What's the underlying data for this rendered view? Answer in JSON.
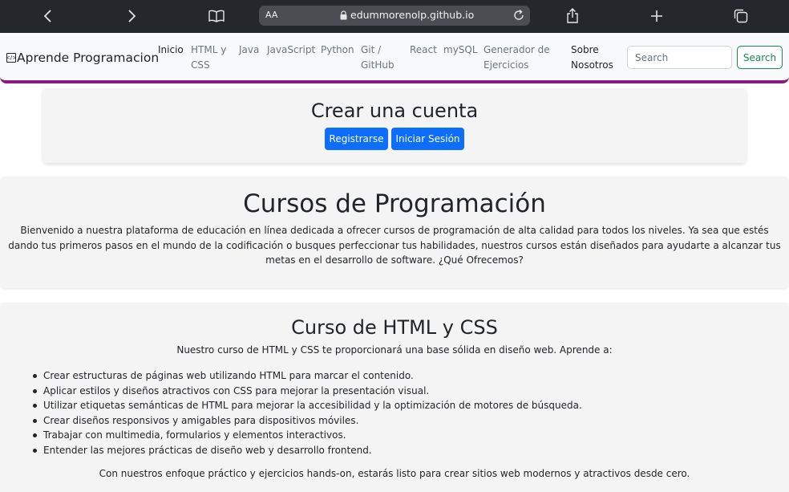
{
  "browser": {
    "text_size_label": "AA",
    "url": "edummorenolp.github.io",
    "icons": [
      "back-icon",
      "forward-icon",
      "bookmarks-icon",
      "lock-icon",
      "reload-icon",
      "share-icon",
      "new-tab-icon",
      "tabs-icon"
    ]
  },
  "navbar": {
    "brand": "Aprende Programacion",
    "links": [
      {
        "label": "Inicio",
        "active": true
      },
      {
        "label": "HTML y\nCSS"
      },
      {
        "label": "Java"
      },
      {
        "label": "JavaScript"
      },
      {
        "label": "Python"
      },
      {
        "label": "Git /\nGitHub"
      },
      {
        "label": "React"
      },
      {
        "label": "mySQL"
      },
      {
        "label": "Generador de\nEjercicios"
      },
      {
        "label": "Sobre\nNosotros",
        "active": true
      }
    ],
    "search_placeholder": "Search",
    "search_button": "Search",
    "accent_color": "#8a1a7e"
  },
  "account": {
    "title": "Crear una cuenta",
    "register_button": "Registrarse",
    "login_button": "Iniciar Sesión"
  },
  "hero": {
    "title": "Cursos de Programación",
    "description": "Bienvenido a nuestra plataforma de educación en línea dedicada a ofrecer cursos de programación de alta calidad para todos los niveles. Ya sea que estés dando tus primeros pasos en el mundo de la codificación o busques perfeccionar tus habilidades, nuestros cursos están diseñados para ayudarte a alcanzar tus metas en el desarrollo de software. ¿Qué Ofrecemos?"
  },
  "course": {
    "title": "Curso de HTML y CSS",
    "intro": "Nuestro curso de HTML y CSS te proporcionará una base sólida en diseño web. Aprende a:",
    "items": [
      "Crear estructuras de páginas web utilizando HTML para marcar el contenido.",
      "Aplicar estilos y diseños atractivos con CSS para mejorar la presentación visual.",
      "Utilizar etiquetas semánticas de HTML para mejorar la accesibilidad y la optimización de motores de búsqueda.",
      "Crear diseños responsivos y amigables para dispositivos móviles.",
      "Trabajar con multimedia, formularios y elementos interactivos.",
      "Entender las mejores prácticas de diseño web y desarrollo frontend."
    ],
    "outro": "Con nuestros enfoque práctico y ejercicios hands-on, estarás listo para crear sitios web modernos y atractivos desde cero."
  }
}
